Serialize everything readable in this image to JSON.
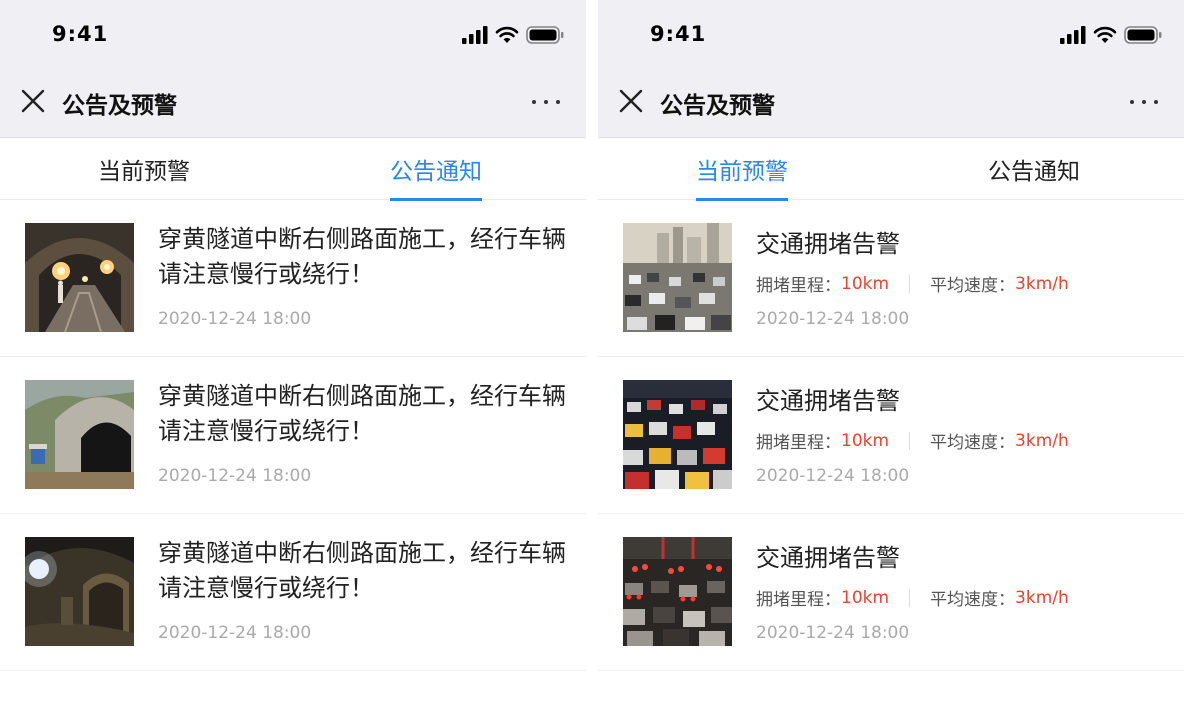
{
  "status_bar": {
    "time": "9:41"
  },
  "nav": {
    "title": "公告及预警"
  },
  "tabs": [
    {
      "label": "当前预警"
    },
    {
      "label": "公告通知"
    }
  ],
  "announcements": [
    {
      "title": "穿黄隧道中断右侧路面施工，经行车辆请注意慢行或绕行！",
      "date": "2020-12-24 18:00"
    },
    {
      "title": "穿黄隧道中断右侧路面施工，经行车辆请注意慢行或绕行！",
      "date": "2020-12-24 18:00"
    },
    {
      "title": "穿黄隧道中断右侧路面施工，经行车辆请注意慢行或绕行！",
      "date": "2020-12-24 18:00"
    }
  ],
  "warnings": [
    {
      "title": "交通拥堵告警",
      "distance_label": "拥堵里程：",
      "distance_value": "10km",
      "speed_label": "平均速度：",
      "speed_value": "3km/h",
      "date": "2020-12-24 18:00"
    },
    {
      "title": "交通拥堵告警",
      "distance_label": "拥堵里程：",
      "distance_value": "10km",
      "speed_label": "平均速度：",
      "speed_value": "3km/h",
      "date": "2020-12-24 18:00"
    },
    {
      "title": "交通拥堵告警",
      "distance_label": "拥堵里程：",
      "distance_value": "10km",
      "speed_label": "平均速度：",
      "speed_value": "3km/h",
      "date": "2020-12-24 18:00"
    }
  ],
  "colors": {
    "accent": "#2a86f0",
    "warning_value": "#e64430",
    "nav_background": "#efeff4"
  }
}
